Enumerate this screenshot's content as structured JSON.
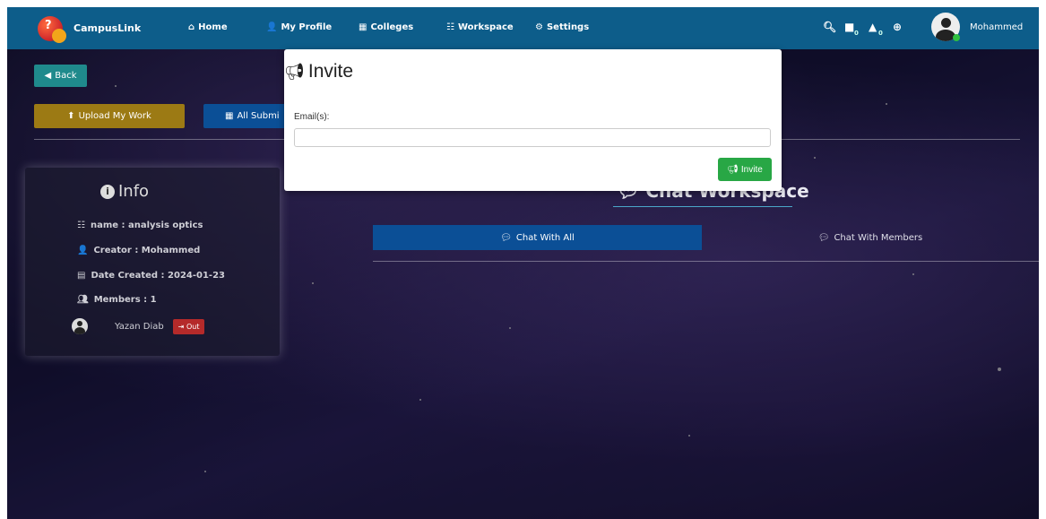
{
  "navbar": {
    "brand": "CampusLink",
    "items": [
      {
        "label": "Home",
        "icon": "home-icon"
      },
      {
        "label": "My Profile",
        "icon": "user-icon"
      },
      {
        "label": "Colleges",
        "icon": "building-icon"
      },
      {
        "label": "Workspace",
        "icon": "sitemap-icon"
      },
      {
        "label": "Settings",
        "icon": "cogs-icon"
      }
    ],
    "messages_count": "0",
    "notifications_count": "0",
    "user_name": "Mohammed"
  },
  "page": {
    "back_label": "Back",
    "upload_label": "Upload My Work",
    "all_submissions_label": "All Submi"
  },
  "info": {
    "title": "Info",
    "name": "name : analysis optics",
    "creator": "Creator : Mohammed",
    "date_created": "Date Created : 2024-01-23",
    "members": "Members : 1",
    "member_name": "Yazan Diab",
    "out_label": "Out"
  },
  "chat": {
    "title": "Chat Workspace",
    "tab_all": "Chat With All",
    "tab_members": "Chat With Members"
  },
  "modal": {
    "title": "Invite",
    "email_label": "Email(s):",
    "email_value": "",
    "invite_button": "Invite"
  },
  "colors": {
    "navbar": "#0d5d8a",
    "invite": "#28a745",
    "tab_active": "#0b4f96",
    "out": "#b52a2a"
  }
}
